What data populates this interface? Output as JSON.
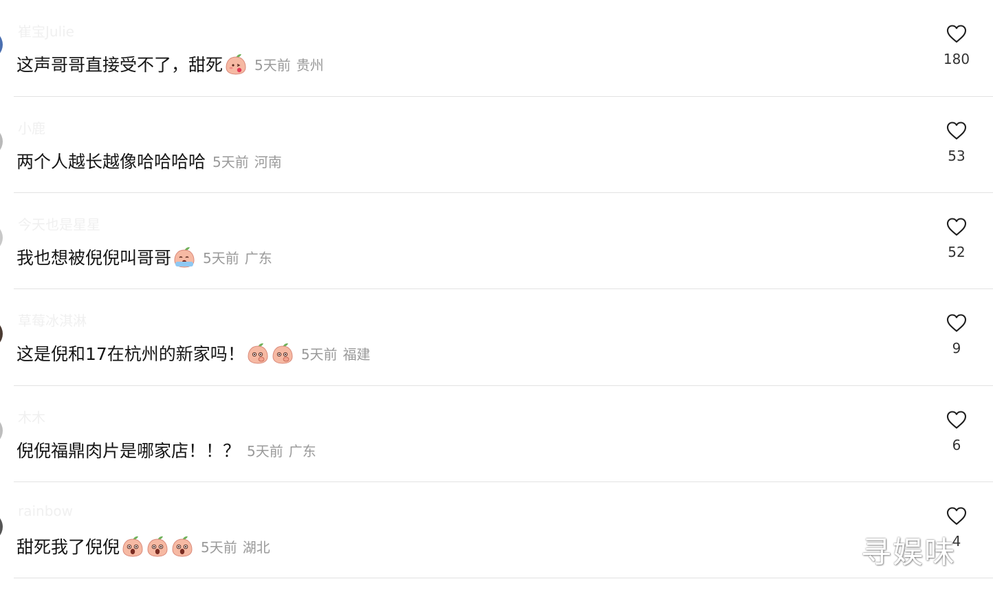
{
  "comments": [
    {
      "username": "崔宝Julie",
      "text": "这声哥哥直接受不了，甜死",
      "emojis": [
        "peach-kiss-emoji"
      ],
      "time": "5天前",
      "region": "贵州",
      "likes": "180",
      "avatar_color": "#4a6fb0"
    },
    {
      "username": "小鹿",
      "text": "两个人越长越像哈哈哈哈",
      "emojis": [],
      "time": "5天前",
      "region": "河南",
      "likes": "53",
      "avatar_color": "#b9b9b9"
    },
    {
      "username": "今天也是星星",
      "text": "我也想被倪倪叫哥哥",
      "emojis": [
        "peach-crying-emoji"
      ],
      "time": "5天前",
      "region": "广东",
      "likes": "52",
      "avatar_color": "#c8c8c8"
    },
    {
      "username": "草莓冰淇淋",
      "text": "这是倪和17在杭州的新家吗！",
      "emojis": [
        "peach-shy-emoji",
        "peach-shy-emoji"
      ],
      "time": "5天前",
      "region": "福建",
      "likes": "9",
      "avatar_color": "#4a3a32"
    },
    {
      "username": "木木",
      "text": "倪倪福鼎肉片是哪家店！！？",
      "emojis": [],
      "time": "5天前",
      "region": "广东",
      "likes": "6",
      "avatar_color": "#bdbdbd"
    },
    {
      "username": "rainbow",
      "text": "甜死我了倪倪",
      "emojis": [
        "peach-shocked-emoji",
        "peach-shocked-emoji",
        "peach-shocked-emoji"
      ],
      "time": "5天前",
      "region": "湖北",
      "likes": "4",
      "avatar_color": "#555555"
    }
  ],
  "icons": {
    "like": "heart-outline-icon"
  },
  "colors": {
    "text": "#161616",
    "meta": "#9a9a9a",
    "divider": "#e2e2e2",
    "peach": "#f6b9a3",
    "leaf": "#6fb15a"
  },
  "watermark": "寻娱味"
}
